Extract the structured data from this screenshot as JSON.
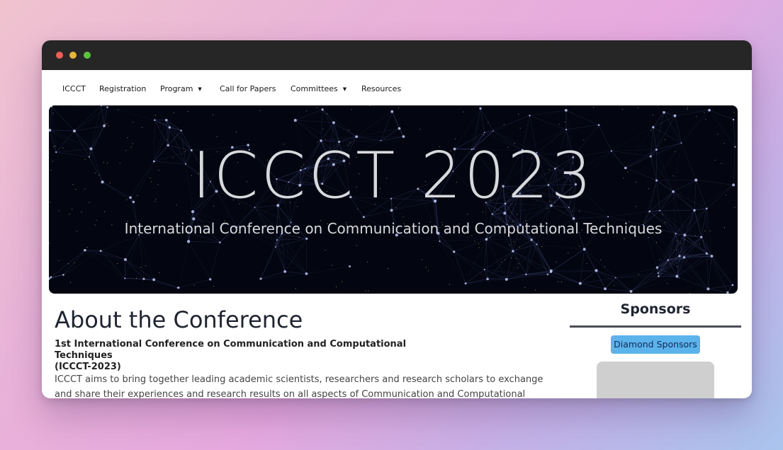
{
  "nav": {
    "items": [
      {
        "label": "ICCCT",
        "dropdown": false
      },
      {
        "label": "Registration",
        "dropdown": false
      },
      {
        "label": "Program",
        "dropdown": true
      },
      {
        "label": "Call for Papers",
        "dropdown": false
      },
      {
        "label": "Committees",
        "dropdown": true
      },
      {
        "label": "Resources",
        "dropdown": false
      }
    ],
    "caret": "▼"
  },
  "banner": {
    "title": "ICCCT 2023",
    "subtitle": "International Conference on Communication and Computational Techniques"
  },
  "about": {
    "title": "About the Conference",
    "subtitle_line1": "1st International Conference on Communication and Computational Techniques",
    "subtitle_line2": "(ICCCT-2023)",
    "body": "ICCCT aims to bring together leading academic scientists, researchers and research scholars to exchange and share their experiences and research results on all aspects of Communication and Computational Techniques. It also provides"
  },
  "sponsors": {
    "heading": "Sponsors",
    "tier": "Diamond Sponsors"
  },
  "colors": {
    "titlebar": "#262626",
    "badge": "#5cb3ec",
    "heading": "#1f2430"
  }
}
